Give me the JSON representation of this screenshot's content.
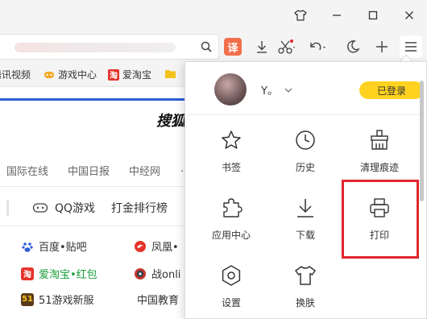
{
  "bookmarks": [
    {
      "label": "腾讯视频",
      "icon": "tencent-video-icon",
      "color": "#ffffff"
    },
    {
      "label": "游戏中心",
      "icon": "gamepad-icon",
      "color": "#f5a623"
    },
    {
      "label": "爱淘宝",
      "icon": "taobao-icon",
      "color": "#e6332a"
    },
    {
      "label": "",
      "icon": "folder-icon",
      "color": "#f5c21b"
    }
  ],
  "toolbar": {
    "translate_label": "译",
    "icons": [
      "search-icon",
      "translate-icon",
      "download-icon",
      "scissors-icon",
      "undo-icon",
      "night-mode-icon",
      "add-icon",
      "menu-icon"
    ]
  },
  "page": {
    "logo_text": "搜狐",
    "nav_links": [
      "国际在线",
      "中国日报",
      "中经网"
    ],
    "middle_row": [
      {
        "label": "QQ游戏",
        "icon": "game-controller-icon"
      },
      {
        "label": "打金排行榜"
      }
    ],
    "sites": [
      {
        "label": "百度•贴吧",
        "icon": "baidu-icon",
        "color": "#333333"
      },
      {
        "label": "凤凰•",
        "icon": "phoenix-icon",
        "color": "#333333"
      },
      {
        "label": "爱淘宝•红包",
        "icon": "taobao-icon",
        "color": "#1a9e3a"
      },
      {
        "label": "战onli",
        "icon": "game-icon",
        "color": "#333333"
      },
      {
        "label": "51游戏新服",
        "icon": "game51-icon",
        "color": "#333333"
      },
      {
        "label": "中国教育",
        "icon": "",
        "color": "#333333"
      }
    ]
  },
  "menu": {
    "username": "Y。",
    "login_status": "已登录",
    "items": [
      {
        "label": "书签",
        "icon": "star-icon"
      },
      {
        "label": "历史",
        "icon": "clock-icon"
      },
      {
        "label": "清理痕迹",
        "icon": "broom-icon"
      },
      {
        "label": "应用中心",
        "icon": "puzzle-icon"
      },
      {
        "label": "下载",
        "icon": "download-icon"
      },
      {
        "label": "打印",
        "icon": "printer-icon"
      },
      {
        "label": "设置",
        "icon": "settings-icon"
      },
      {
        "label": "换肤",
        "icon": "shirt-icon"
      }
    ]
  },
  "colors": {
    "accent": "#ffd21f",
    "highlight": "#e0262d",
    "link_blue": "#2d5fd6",
    "translate": "#f26e4b"
  }
}
